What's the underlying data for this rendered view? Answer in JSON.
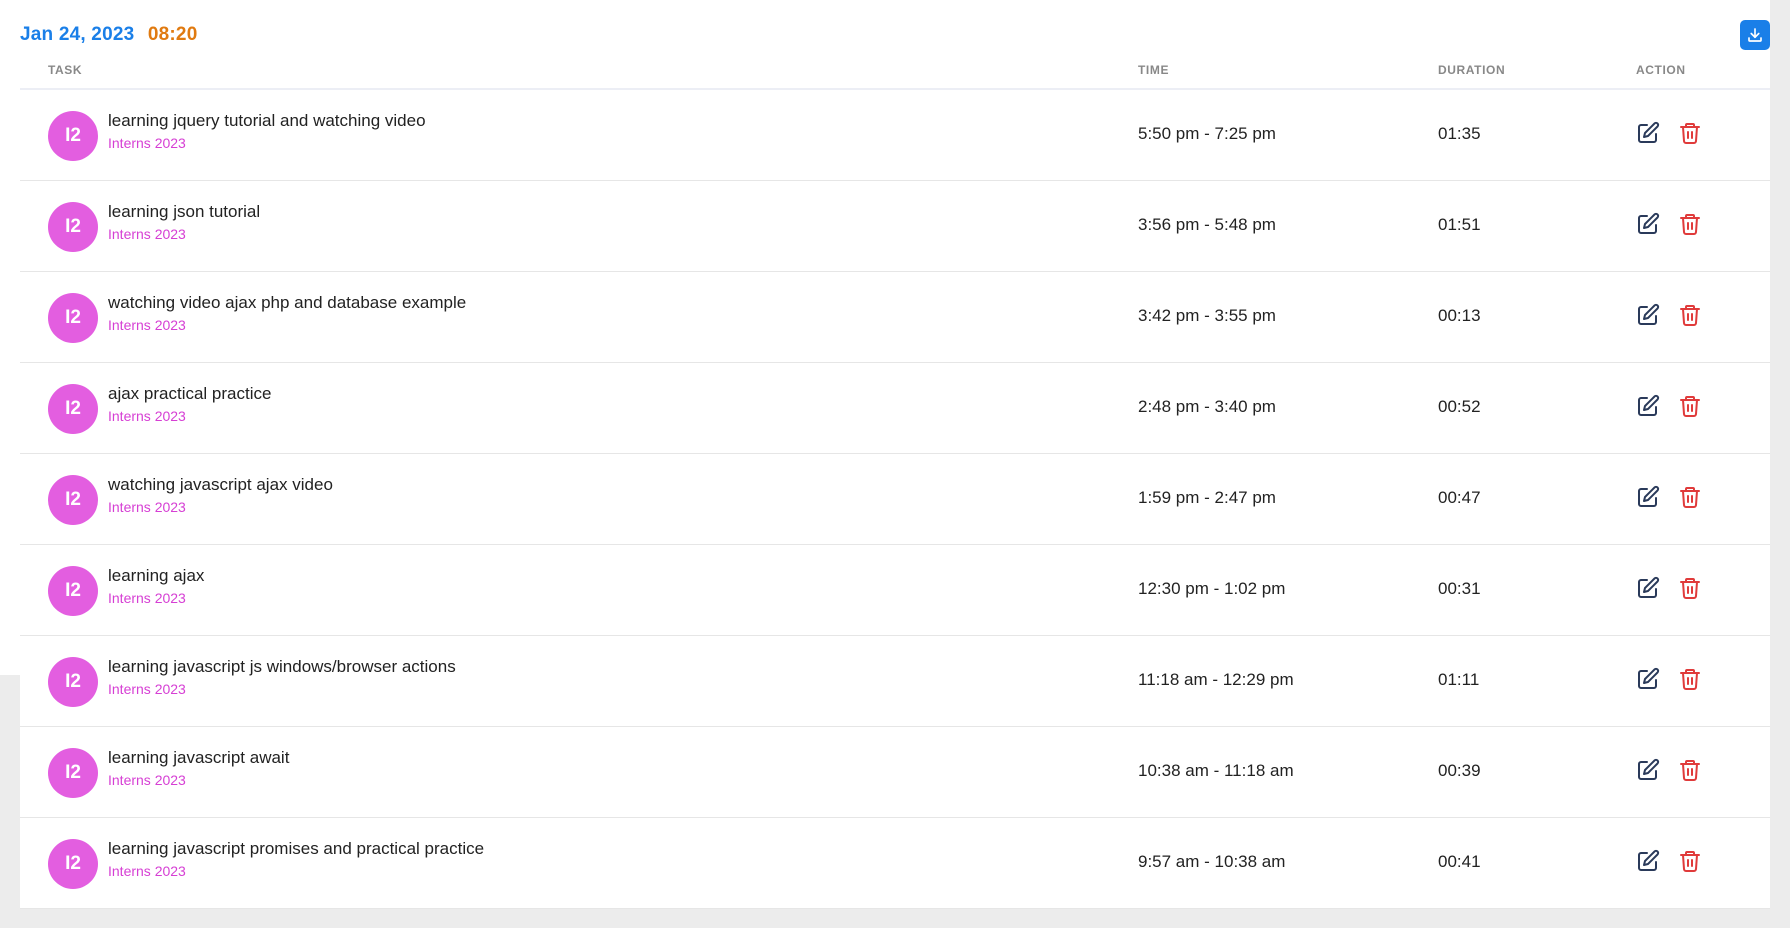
{
  "header": {
    "date": "Jan 24, 2023",
    "total": "08:20"
  },
  "columns": {
    "task": "TASK",
    "time": "TIME",
    "duration": "DURATION",
    "action": "ACTION"
  },
  "colors": {
    "accent": "#1a7fe8",
    "total": "#e07a10",
    "avatar": "#e35ee0",
    "project": "#d63fd4",
    "delete": "#e03b3b"
  },
  "icons": {
    "download": "download-icon",
    "edit": "edit-icon",
    "delete": "trash-icon"
  },
  "rows": [
    {
      "avatar": "I2",
      "title": "learning jquery tutorial and watching video",
      "project": "Interns 2023",
      "time": "5:50 pm - 7:25 pm",
      "duration": "01:35"
    },
    {
      "avatar": "I2",
      "title": "learning json tutorial",
      "project": "Interns 2023",
      "time": "3:56 pm - 5:48 pm",
      "duration": "01:51"
    },
    {
      "avatar": "I2",
      "title": "watching video ajax php and database example",
      "project": "Interns 2023",
      "time": "3:42 pm - 3:55 pm",
      "duration": "00:13"
    },
    {
      "avatar": "I2",
      "title": "ajax practical practice",
      "project": "Interns 2023",
      "time": "2:48 pm - 3:40 pm",
      "duration": "00:52"
    },
    {
      "avatar": "I2",
      "title": "watching javascript ajax video",
      "project": "Interns 2023",
      "time": "1:59 pm - 2:47 pm",
      "duration": "00:47"
    },
    {
      "avatar": "I2",
      "title": "learning ajax",
      "project": "Interns 2023",
      "time": "12:30 pm - 1:02 pm",
      "duration": "00:31"
    },
    {
      "avatar": "I2",
      "title": "learning javascript js windows/browser actions",
      "project": "Interns 2023",
      "time": "11:18 am - 12:29 pm",
      "duration": "01:11"
    },
    {
      "avatar": "I2",
      "title": "learning javascript await",
      "project": "Interns 2023",
      "time": "10:38 am - 11:18 am",
      "duration": "00:39"
    },
    {
      "avatar": "I2",
      "title": "learning javascript promises and practical practice",
      "project": "Interns 2023",
      "time": "9:57 am - 10:38 am",
      "duration": "00:41"
    }
  ]
}
